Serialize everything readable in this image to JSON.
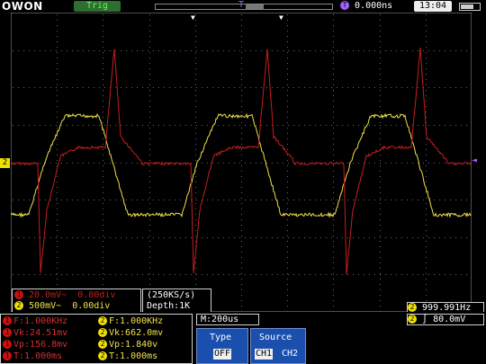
{
  "header": {
    "logo_text": "OWON",
    "trig_label": "Trig",
    "trigger_marker": "T",
    "time_offset_badge": "T",
    "time_offset": "0.000ns",
    "clock": "13:04"
  },
  "channel_markers": {
    "ch2_left": "2",
    "trig_level_right": "◄"
  },
  "channel_settings": {
    "ch1": {
      "badge": "1",
      "scale": "20.0mV~",
      "offset": "0.00div"
    },
    "ch2": {
      "badge": "2",
      "scale": "500mV~",
      "offset": "0.00div"
    }
  },
  "acquisition": {
    "rate": "(250KS/s)",
    "depth": "Depth:1K"
  },
  "trigger_freq": {
    "badge": "2",
    "value": "999.991Hz"
  },
  "measurements": {
    "ch1": [
      {
        "badge": "1",
        "text": "F:1.000KHz"
      },
      {
        "badge": "1",
        "text": "Vk:24.51mv"
      },
      {
        "badge": "1",
        "text": "Vp:156.8mv"
      },
      {
        "badge": "1",
        "text": "T:1.000ms"
      }
    ],
    "ch2": [
      {
        "badge": "2",
        "text": "F:1.000KHz"
      },
      {
        "badge": "2",
        "text": "Vk:662.0mv"
      },
      {
        "badge": "2",
        "text": "Vp:1.840v"
      },
      {
        "badge": "2",
        "text": "T:1.000ms"
      }
    ]
  },
  "timebase": "M:200us",
  "trigger_level": {
    "badge": "2",
    "edge": "∫",
    "value": "80.0mV"
  },
  "menu": {
    "type": {
      "title": "Type",
      "value": "OFF"
    },
    "source": {
      "title": "Source",
      "option1": "CH1",
      "option2": "CH2"
    }
  },
  "colors": {
    "ch1": "#c41e1e",
    "ch2": "#f0e04a",
    "grid": "#6a6a6a",
    "accent_blue": "#1b4fae"
  }
}
